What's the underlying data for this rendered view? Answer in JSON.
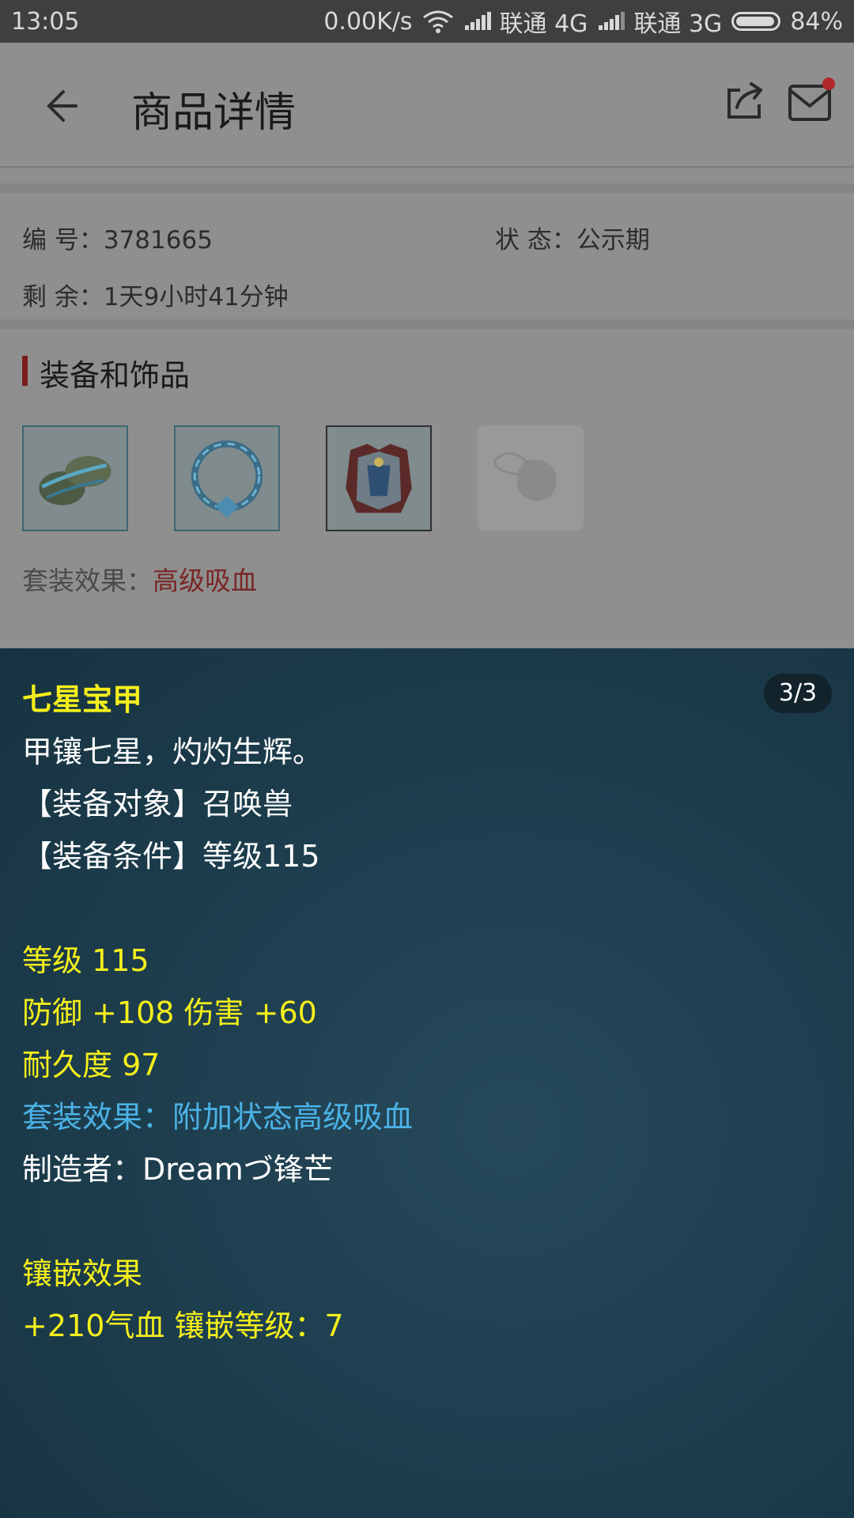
{
  "status_bar": {
    "time": "13:05",
    "speed": "0.00K/s",
    "carrier1": "联通 4G",
    "carrier2": "联通 3G",
    "battery": "84%"
  },
  "header": {
    "title": "商品详情"
  },
  "listing": {
    "id_label": "编  号：",
    "id_value": "3781665",
    "status_label": "状  态：",
    "status_value": "公示期",
    "remaining_label": "剩  余：",
    "remaining_value": "1天9小时41分钟"
  },
  "equipment": {
    "section_title": "装备和饰品",
    "items": [
      {
        "icon": "armguard-icon"
      },
      {
        "icon": "ring-icon"
      },
      {
        "icon": "armor-icon"
      },
      {
        "icon": "empty-slot-icon"
      }
    ],
    "suit_label": "套装效果：",
    "suit_value": "高级吸血"
  },
  "detail": {
    "pager": "3/3",
    "name": "七星宝甲",
    "desc": "甲镶七星，灼灼生辉。",
    "target": "【装备对象】召唤兽",
    "requirement": "【装备条件】等级115",
    "level": "等级 115",
    "stats": "防御 +108 伤害 +60",
    "durability": "耐久度 97",
    "suit_effect": "套装效果：附加状态高级吸血",
    "maker": "制造者：Dreamづ锋芒",
    "inlay_title": "镶嵌效果",
    "inlay_value": "+210气血 镶嵌等级：7"
  }
}
